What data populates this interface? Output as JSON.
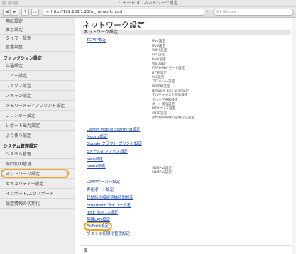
{
  "window": {
    "title": "リモートUI：ネットワーク設定"
  },
  "toolbar": {
    "url": "http://192.168.1.20/m_network.html",
    "search_placeholder": "Google"
  },
  "sidebar": {
    "items_top": [
      "用紙設定",
      "表示設定",
      "タイマー設定",
      "音量調整"
    ],
    "section1": "ファンクション設定",
    "items_mid": [
      "共通設定",
      "コピー設定",
      "ファクス設定",
      "スキャン設定",
      "メモリーメディアプリント設定",
      "プリンター設定",
      "レポート出力設定",
      "よく使う設定"
    ],
    "section2": "システム管理設定",
    "items_bottom": [
      "システム管理",
      "部門別ID管理",
      "ネットワーク設定",
      "セキュリティー設定",
      "インポート/エクスポート",
      "設定情報の初期化"
    ],
    "active": "ネットワーク設定"
  },
  "main": {
    "title": "ネットワーク設定",
    "section": "ネットワーク設定",
    "tcpip": {
      "label": "TCP/IP設定",
      "subitems": [
        "IPv4設定",
        "IPv6設定",
        "WINS設定",
        "LPD設定",
        "RAW設定",
        "WSD設定",
        "FTP(PASV)モード設定",
        "HTTP設定",
        "SSL設定",
        "プロキシー設定",
        "IPP印刷設定",
        "Network Link Scan設定",
        "マルチキャスト探索設定",
        "スリープ通知設定",
        "ポート番号設定",
        "MTUサイズ設定",
        "SNTP設定",
        "部門別印刷時の強制認証設定"
      ]
    },
    "links_a": [
      "Canon Mobile Scanning設定",
      "Mopria設定",
      "Google クラウド プリント設定",
      "Eメール/I ファクス設定",
      "SMB設定"
    ],
    "snmp": {
      "label": "SNMP設定",
      "subitems": [
        "SNMPv1設定",
        "SNMPv3設定"
      ]
    },
    "links_b": [
      "LDAPサーバー設定",
      "専用ポート設定",
      "起動時の接続待機時間設定",
      "Ethernetドライバー設定",
      "IEEE 802.1X設定",
      "無線LAN設定",
      "AirPrint設定",
      "ゲストID初期化管理設定"
    ],
    "footer": "変"
  }
}
